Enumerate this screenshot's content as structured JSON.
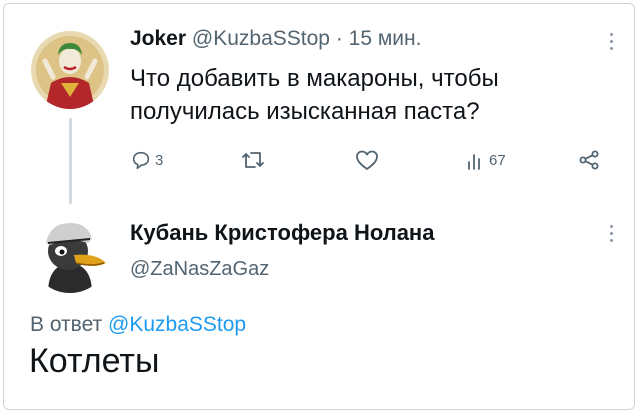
{
  "tweet1": {
    "author_name": "Joker",
    "handle": "@KuzbaSStop",
    "separator": "·",
    "time": "15 мин.",
    "text": "Что добавить в макароны, чтобы получилась изысканная паста?",
    "avatar_icon": "joker-avatar-icon",
    "actions": {
      "reply_count": "3",
      "retweet_count": "",
      "like_count": "",
      "views_count": "67"
    }
  },
  "tweet2": {
    "author_name": "Кубань Кристофера Нолана",
    "handle": "@ZaNasZaGaz",
    "reply_prefix": "В ответ",
    "reply_to": "@KuzbaSStop",
    "text": "Котлеты",
    "avatar_icon": "duck-avatar-icon"
  },
  "colors": {
    "text": "#0f1419",
    "muted": "#536471",
    "link": "#1d9bf0",
    "thread_line": "#cfd9de"
  }
}
